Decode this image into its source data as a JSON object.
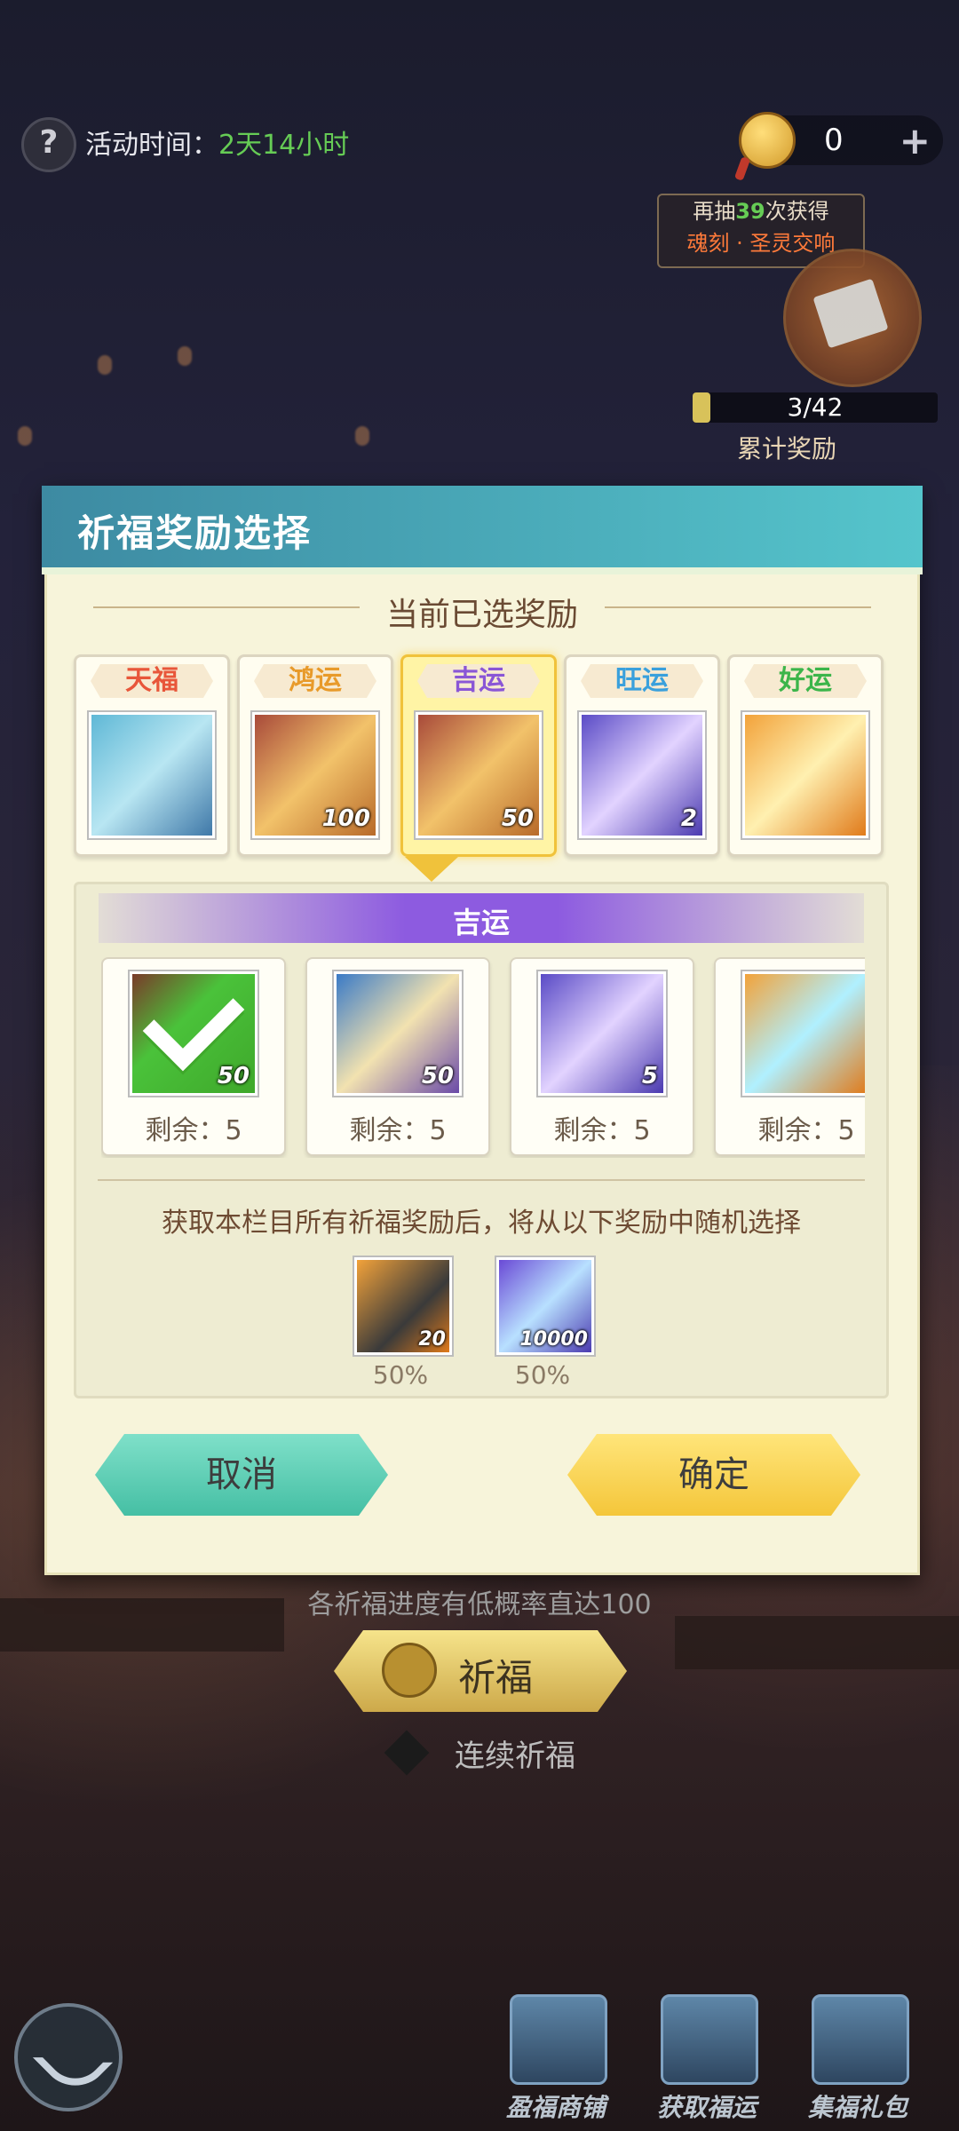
{
  "topbar": {
    "activity_label": "活动时间：",
    "activity_time": "2天14小时",
    "currency_value": "0"
  },
  "milestone": {
    "line1_prefix": "再抽",
    "line1_count": "39",
    "line1_suffix": "次获得",
    "line2": "魂刻 · 圣灵交响",
    "progress_text": "3/42",
    "progress_value": 0.071,
    "label": "累计奖励"
  },
  "modal": {
    "title": "祈福奖励选择",
    "section_title": "当前已选奖励",
    "tiers": [
      {
        "name": "天福",
        "count": "",
        "color": "#e8563a",
        "icon": "silver-armor-icon"
      },
      {
        "name": "鸿运",
        "count": "100",
        "color": "#e89a2a",
        "icon": "gold-armor-icon"
      },
      {
        "name": "吉运",
        "count": "50",
        "color": "#8a56d6",
        "icon": "gold-armor-icon",
        "selected": true
      },
      {
        "name": "旺运",
        "count": "2",
        "color": "#3aa0dc",
        "icon": "purple-rune-icon"
      },
      {
        "name": "好运",
        "count": "",
        "color": "#3cb54a",
        "icon": "amulet-icon"
      }
    ],
    "panel_title": "吉运",
    "rewards": [
      {
        "count": "50",
        "remain": "剩余：5",
        "icon": "gold-armor-icon",
        "checked": true
      },
      {
        "count": "50",
        "remain": "剩余：5",
        "icon": "spell-book-icon"
      },
      {
        "count": "5",
        "remain": "剩余：5",
        "icon": "purple-rune-icon"
      },
      {
        "count": "",
        "remain": "剩余：5",
        "icon": "trophy-icon"
      }
    ],
    "random_text": "获取本栏目所有祈福奖励后，将从以下奖励中随机选择",
    "random_items": [
      {
        "count": "20",
        "percent": "50%",
        "icon": "boot-stone-icon"
      },
      {
        "count": "10000",
        "percent": "50%",
        "icon": "blue-crystal-icon"
      }
    ],
    "cancel_label": "取消",
    "confirm_label": "确定"
  },
  "bottom": {
    "hint": "各祈福进度有低概率直达100",
    "pray_label": "祈福",
    "continuous_label": "连续祈福"
  },
  "dock": {
    "items": [
      {
        "label": "盈福商铺",
        "icon": "shop-chest-icon"
      },
      {
        "label": "获取福运",
        "icon": "book-icon"
      },
      {
        "label": "集福礼包",
        "icon": "gift-icon"
      }
    ]
  }
}
